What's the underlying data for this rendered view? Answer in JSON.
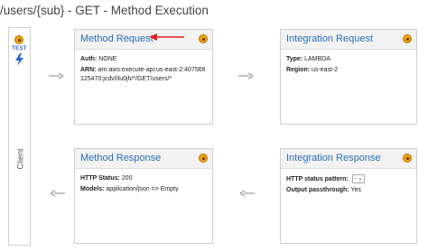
{
  "page_title": "/users/{sub} - GET - Method Execution",
  "client": {
    "test_label": "TEST",
    "client_label": "Client"
  },
  "method_request": {
    "title": "Method Request",
    "auth_label": "Auth:",
    "auth_value": "NONE",
    "arn_label": "ARN:",
    "arn_value": "arn:aws:execute-api:us-east-2:407566125470:jcdv0lu0jh/*/GET/users/*"
  },
  "integration_request": {
    "title": "Integration Request",
    "type_label": "Type:",
    "type_value": "LAMBDA",
    "region_label": "Region:",
    "region_value": "us-east-2"
  },
  "method_response": {
    "title": "Method Response",
    "status_label": "HTTP Status:",
    "status_value": "200",
    "models_label": "Models:",
    "models_value": "application/json => Empty"
  },
  "integration_response": {
    "title": "Integration Response",
    "pattern_label": "HTTP status pattern:",
    "pattern_value": "-",
    "passthrough_label": "Output passthrough:",
    "passthrough_value": "Yes"
  },
  "colors": {
    "link": "#2a6ebb",
    "badge": "#f2a20a",
    "annotation_arrow": "#e02020",
    "flow_arrow": "#999999"
  },
  "icons": [
    "test-badge-icon",
    "lightning-bolt-icon",
    "status-dot-icon",
    "right-arrow-icon",
    "left-arrow-icon",
    "annotation-arrow-icon",
    "chevron-down-icon"
  ]
}
